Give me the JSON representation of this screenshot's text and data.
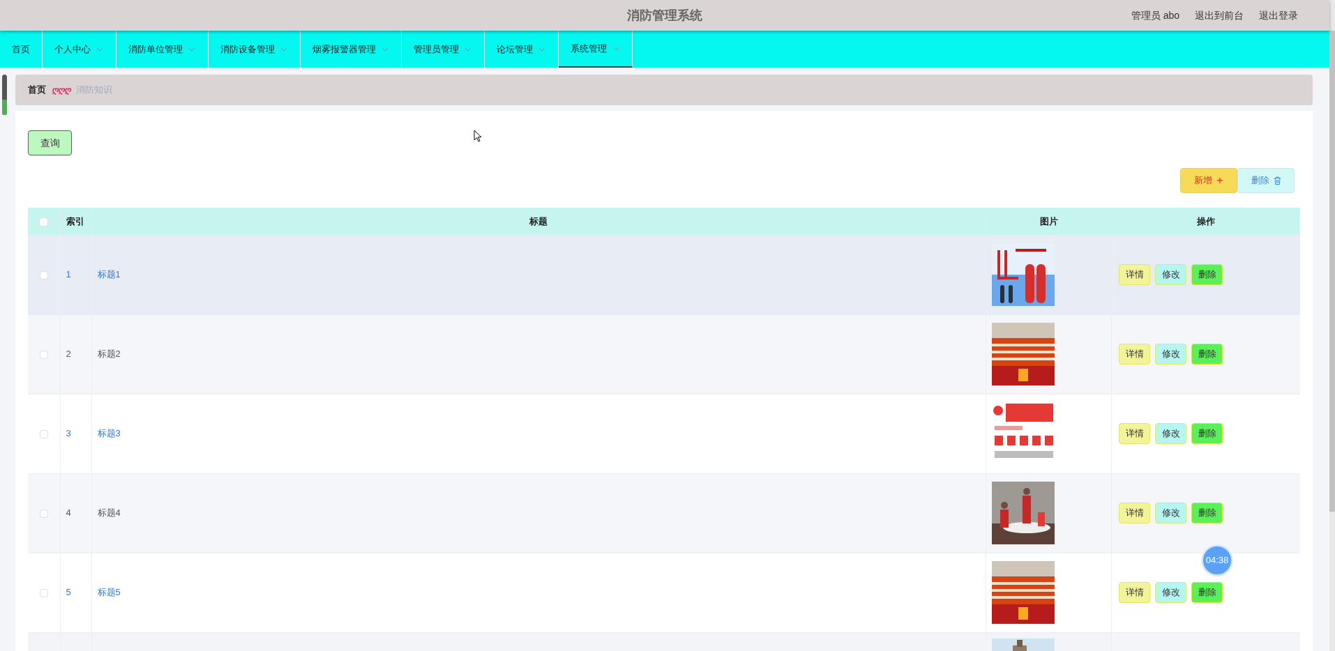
{
  "header": {
    "title": "消防管理系统",
    "user": "管理员 abo",
    "links": [
      "退出到前台",
      "退出登录"
    ]
  },
  "nav": [
    {
      "label": "首页",
      "has_menu": false,
      "selected": false
    },
    {
      "label": "个人中心",
      "has_menu": true,
      "selected": false
    },
    {
      "label": "消防单位管理",
      "has_menu": true,
      "selected": false
    },
    {
      "label": "消防设备管理",
      "has_menu": true,
      "selected": false
    },
    {
      "label": "烟雾报警器管理",
      "has_menu": true,
      "selected": false
    },
    {
      "label": "管理员管理",
      "has_menu": true,
      "selected": false
    },
    {
      "label": "论坛管理",
      "has_menu": true,
      "selected": false
    },
    {
      "label": "系统管理",
      "has_menu": true,
      "selected": true
    }
  ],
  "breadcrumb": {
    "home": "首页",
    "separator": "ღღღ",
    "current": "消防知识"
  },
  "search_button": "查询",
  "actions": [
    {
      "kind": "add",
      "label": "新增",
      "icon": "+"
    },
    {
      "kind": "delete",
      "label": "删除"
    }
  ],
  "table": {
    "select_all": {
      "checked": false
    },
    "columns": [
      "索引",
      "标题",
      "图片",
      "操作"
    ],
    "rows": [
      {
        "index": "1",
        "title": "标题1",
        "link": true,
        "hovered": true,
        "checked": false,
        "image": {
          "kind": "picture"
        },
        "buttons": [
          "详情",
          "修改",
          "删除"
        ]
      },
      {
        "index": "2",
        "title": "标题2",
        "link": false,
        "hovered": false,
        "checked": false,
        "image": {
          "kind": "picture"
        },
        "buttons": [
          "详情",
          "修改",
          "删除"
        ]
      },
      {
        "index": "3",
        "title": "标题3",
        "link": true,
        "hovered": false,
        "checked": false,
        "image": {
          "kind": "picture"
        },
        "buttons": [
          "详情",
          "修改",
          "删除"
        ]
      },
      {
        "index": "4",
        "title": "标题4",
        "link": false,
        "hovered": false,
        "checked": false,
        "image": {
          "kind": "picture"
        },
        "buttons": [
          "详情",
          "修改",
          "删除"
        ]
      },
      {
        "index": "5",
        "title": "标题5",
        "link": true,
        "hovered": false,
        "checked": false,
        "image": {
          "kind": "picture"
        },
        "buttons": [
          "详情",
          "修改",
          "删除"
        ]
      }
    ],
    "cut_off_row": {
      "image": {
        "kind": "picture"
      }
    }
  },
  "timer": "04:38"
}
